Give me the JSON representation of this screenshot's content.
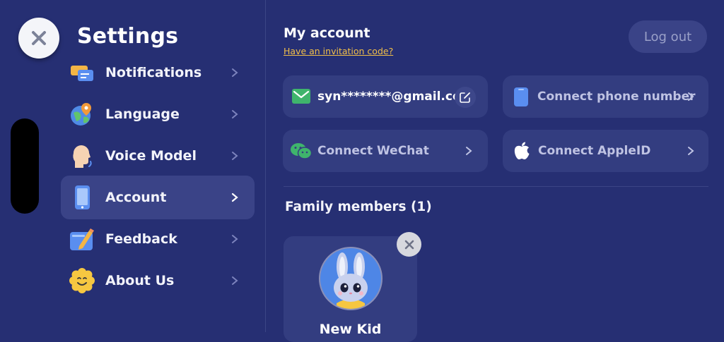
{
  "sidebar": {
    "title": "Settings",
    "items": [
      {
        "label": "Notifications",
        "icon": "notification-icon"
      },
      {
        "label": "Language",
        "icon": "globe-pin-icon"
      },
      {
        "label": "Voice Model",
        "icon": "voice-head-icon"
      },
      {
        "label": "Account",
        "icon": "phone-icon",
        "active": true
      },
      {
        "label": "Feedback",
        "icon": "feedback-pencil-icon"
      },
      {
        "label": "About Us",
        "icon": "smiley-flower-icon"
      }
    ]
  },
  "account": {
    "title": "My account",
    "invite_link": "Have an invitation code?",
    "logout_label": "Log out",
    "email": "syn********@gmail.com",
    "connect_phone": "Connect phone number",
    "connect_wechat": "Connect WeChat",
    "connect_apple": "Connect AppleID"
  },
  "family": {
    "title": "Family members (1)",
    "members": [
      {
        "name": "New Kid",
        "avatar": "bunny-avatar-icon"
      }
    ]
  },
  "colors": {
    "background": "#262f73",
    "card": "#333d80",
    "active_item": "#3a4387",
    "link": "#f2bf49"
  }
}
